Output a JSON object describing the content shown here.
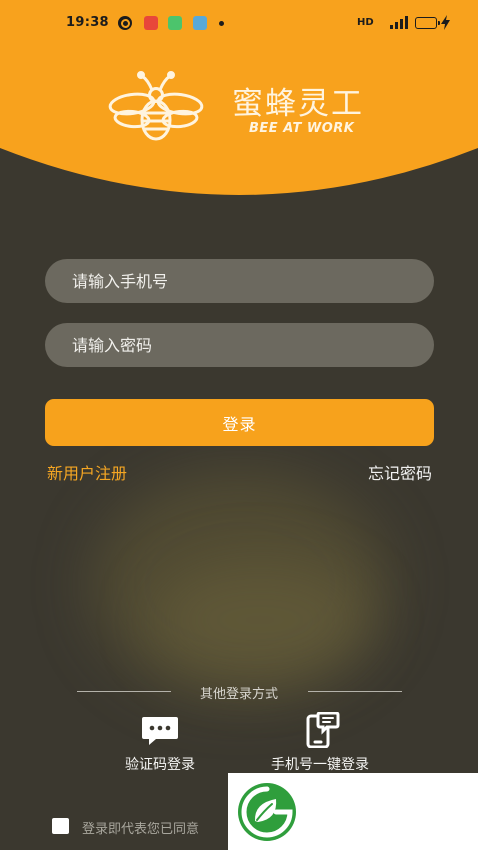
{
  "status_bar": {
    "time": "19:38",
    "network_label": "HD",
    "notification_icons": [
      "quark-icon",
      "red-app-icon",
      "green-app-icon",
      "blue-app-icon"
    ],
    "charging": true
  },
  "brand": {
    "name": "蜜蜂灵工",
    "tagline": "BEE AT WORK",
    "logo_icon": "bee-icon"
  },
  "login_form": {
    "phone_placeholder": "请输入手机号",
    "password_placeholder": "请输入密码",
    "submit_label": "登录",
    "register_link": "新用户注册",
    "forgot_link": "忘记密码"
  },
  "other_login": {
    "title": "其他登录方式",
    "methods": [
      {
        "label": "验证码登录",
        "icon": "sms-code-icon"
      },
      {
        "label": "手机号一键登录",
        "icon": "phone-one-tap-icon"
      }
    ]
  },
  "agreement": {
    "text": "登录即代表您已同意",
    "checked": false
  },
  "colors": {
    "accent": "#F7A21C",
    "background": "#3B382F",
    "input_background": "#6C695F",
    "register_link": "#F5A623"
  }
}
